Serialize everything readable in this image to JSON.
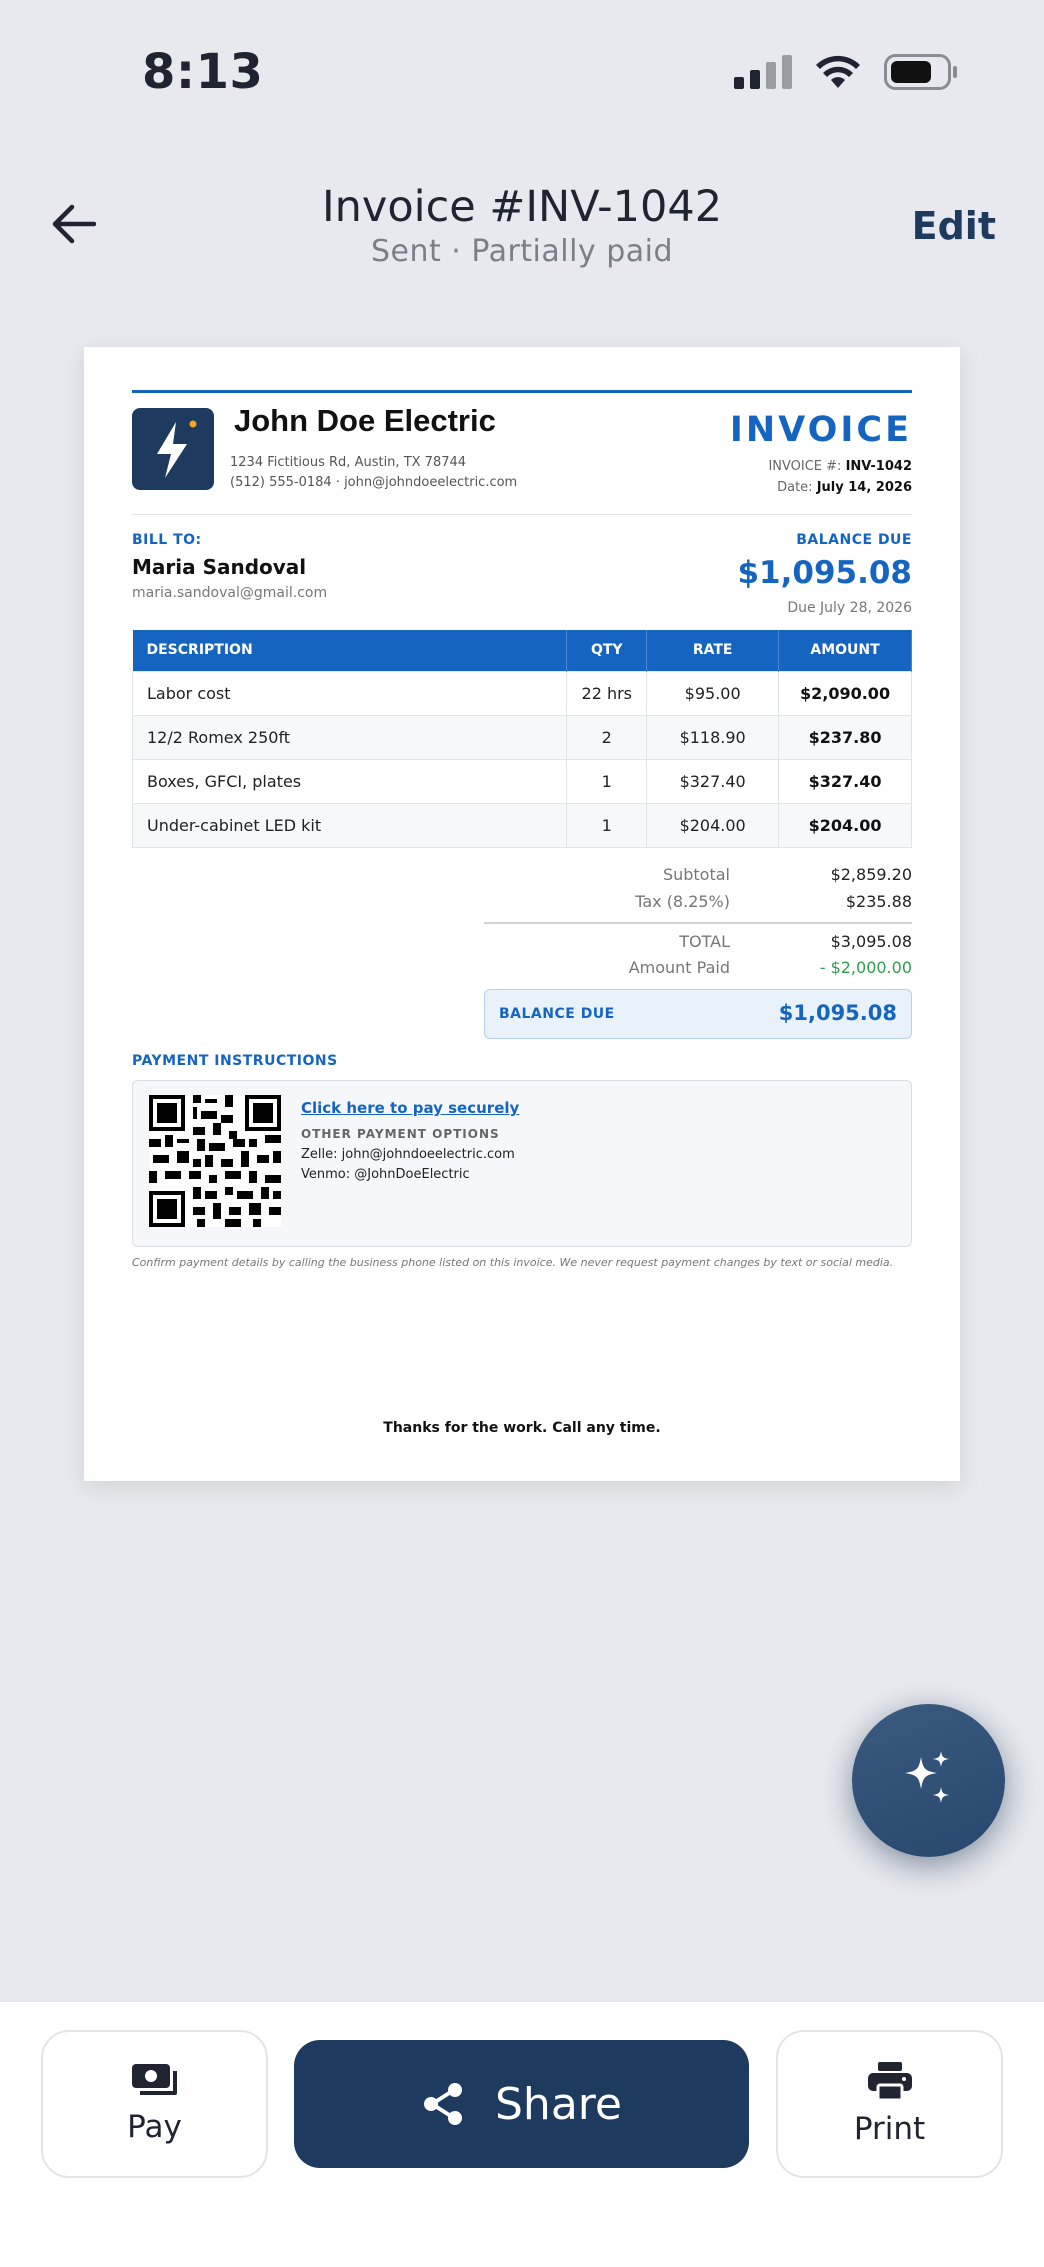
{
  "status_bar": {
    "time": "8:13"
  },
  "nav": {
    "title": "Invoice #INV-1042",
    "subtitle": "Sent · Partially paid",
    "edit_label": "Edit"
  },
  "invoice": {
    "business": {
      "name": "John Doe Electric",
      "address": "1234 Fictitious Rd, Austin, TX 78744",
      "contact": "(512) 555-0184  ·  john@johndoeelectric.com"
    },
    "doc_title": "INVOICE",
    "number_label": "INVOICE #:",
    "number": "INV-1042",
    "date_label": "Date:",
    "date": "July 14, 2026",
    "bill_to_label": "BILL TO:",
    "client_name": "Maria Sandoval",
    "client_email": "maria.sandoval@gmail.com",
    "balance_due_label": "BALANCE DUE",
    "balance_due": "$1,095.08",
    "due_date": "Due July 28, 2026",
    "columns": [
      "DESCRIPTION",
      "QTY",
      "RATE",
      "AMOUNT"
    ],
    "line_items": [
      {
        "description": "Labor cost",
        "qty": "22 hrs",
        "rate": "$95.00",
        "amount": "$2,090.00"
      },
      {
        "description": "12/2 Romex 250ft",
        "qty": "2",
        "rate": "$118.90",
        "amount": "$237.80"
      },
      {
        "description": "Boxes, GFCI, plates",
        "qty": "1",
        "rate": "$327.40",
        "amount": "$327.40"
      },
      {
        "description": "Under-cabinet LED kit",
        "qty": "1",
        "rate": "$204.00",
        "amount": "$204.00"
      }
    ],
    "totals": {
      "subtotal_label": "Subtotal",
      "subtotal": "$2,859.20",
      "tax_label": "Tax (8.25%)",
      "tax": "$235.88",
      "total_label": "TOTAL",
      "total": "$3,095.08",
      "paid_label": "Amount Paid",
      "paid": "- $2,000.00",
      "balance_label": "BALANCE DUE",
      "balance": "$1,095.08"
    },
    "payment": {
      "section_label": "PAYMENT INSTRUCTIONS",
      "pay_link": "Click here to pay securely",
      "other_label": "OTHER PAYMENT OPTIONS",
      "zelle": "Zelle: john@johndoeelectric.com",
      "venmo": "Venmo: @JohnDoeElectric"
    },
    "disclaimer": "Confirm payment details by calling the business phone listed on this invoice. We never request payment changes by text or social media.",
    "thanks": "Thanks for the work. Call any time."
  },
  "actions": {
    "pay_label": "Pay",
    "share_label": "Share",
    "print_label": "Print"
  },
  "colors": {
    "accent": "#1565c0",
    "navy": "#1e3a5f",
    "paid_green": "#2e9e4f"
  },
  "icons": [
    "back-arrow-icon",
    "signal-icon",
    "wifi-icon",
    "battery-icon",
    "bolt-icon",
    "qr-code-icon",
    "sparkle-icon",
    "cash-icon",
    "share-icon",
    "printer-icon"
  ]
}
